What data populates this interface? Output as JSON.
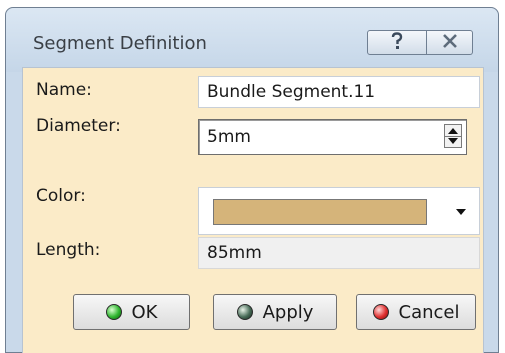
{
  "window": {
    "title": "Segment Definition",
    "help_glyph": "?",
    "close_glyph": "X"
  },
  "form": {
    "name_label": "Name:",
    "name_value": "Bundle Segment.11",
    "diameter_label": "Diameter:",
    "diameter_value": "5mm",
    "color_label": "Color:",
    "color_value": "#d5b47a",
    "length_label": "Length:",
    "length_value": "85mm"
  },
  "buttons": {
    "ok_label": "OK",
    "apply_label": "Apply",
    "cancel_label": "Cancel"
  },
  "colors": {
    "client_bg": "#fbebc8",
    "ok_led": "green",
    "apply_led": "gray",
    "cancel_led": "red"
  }
}
